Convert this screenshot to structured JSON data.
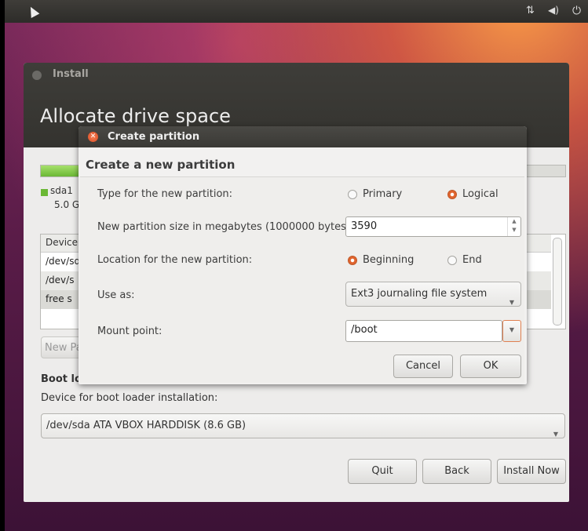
{
  "window": {
    "title": "Install",
    "heading": "Allocate drive space"
  },
  "disk": {
    "used_fraction": 0.6,
    "legend": {
      "name": "sda1",
      "size": "5.0 G"
    }
  },
  "table": {
    "header": "Device",
    "rows": [
      "/dev/sd",
      "/dev/s",
      "free s"
    ]
  },
  "partition_buttons": {
    "new": "New Pa"
  },
  "boot": {
    "heading": "Boot lo",
    "label": "Device for boot loader installation:",
    "device": "/dev/sda ATA VBOX HARDDISK (8.6 GB)"
  },
  "footer": {
    "quit": "Quit",
    "back": "Back",
    "install": "Install Now"
  },
  "dialog": {
    "title": "Create partition",
    "heading": "Create a new partition",
    "type_label": "Type for the new partition:",
    "type_options": [
      "Primary",
      "Logical"
    ],
    "type_selected": "Logical",
    "size_label": "New partition size in megabytes (1000000 bytes):",
    "size_value": "3590",
    "location_label": "Location for the new partition:",
    "location_options": [
      "Beginning",
      "End"
    ],
    "location_selected": "Beginning",
    "use_as_label": "Use as:",
    "use_as_value": "Ext3 journaling file system",
    "mount_label": "Mount point:",
    "mount_value": "/boot",
    "cancel": "Cancel",
    "ok": "OK"
  },
  "colors": {
    "accent": "#e0642e",
    "progress": "#6bb835",
    "titlebar": "#3e3d39"
  }
}
